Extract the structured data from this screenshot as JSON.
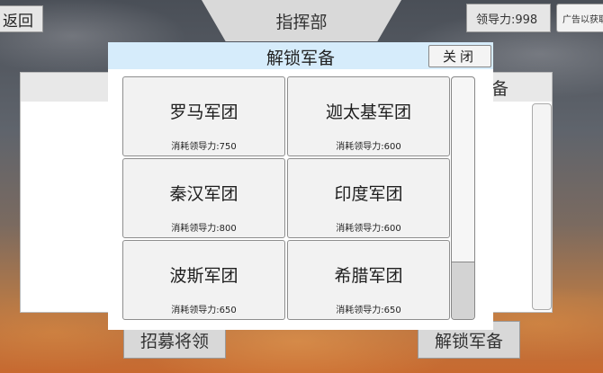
{
  "header": {
    "back_label": "返回",
    "title": "指挥部",
    "leadership": "领导力:998",
    "ad_label": "广告以获取"
  },
  "background_panel": {
    "title": "备"
  },
  "bottom": {
    "recruit_label": "招募将领",
    "unlock_label": "解锁军备"
  },
  "modal": {
    "title": "解锁军备",
    "close_label": "关闭",
    "cards": [
      {
        "name": "罗马军团",
        "cost": "消耗领导力:750"
      },
      {
        "name": "迦太基军团",
        "cost": "消耗领导力:600"
      },
      {
        "name": "秦汉军团",
        "cost": "消耗领导力:800"
      },
      {
        "name": "印度军团",
        "cost": "消耗领导力:600"
      },
      {
        "name": "波斯军团",
        "cost": "消耗领导力:650"
      },
      {
        "name": "希腊军团",
        "cost": "消耗领导力:650"
      }
    ],
    "scroll_position": 0.76
  }
}
